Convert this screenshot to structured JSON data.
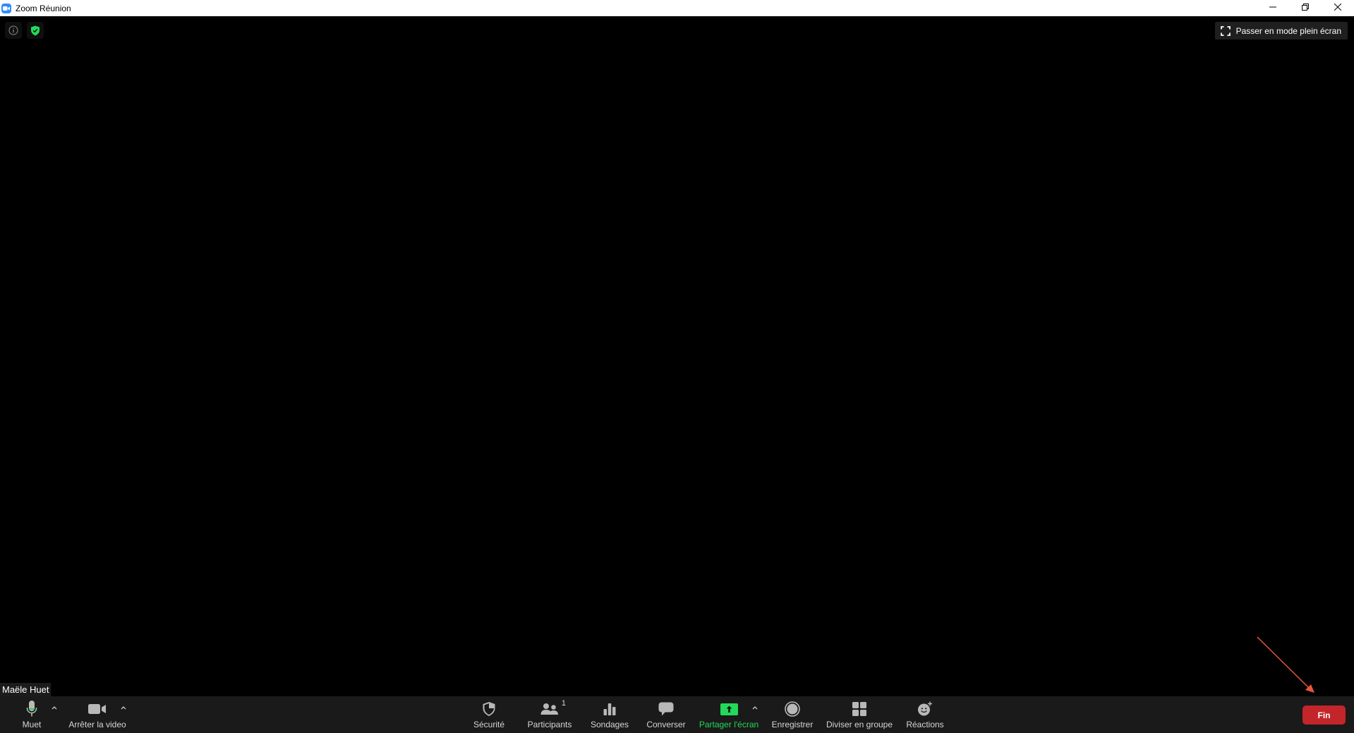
{
  "window": {
    "title": "Zoom Réunion",
    "icon": "zoom-camera-icon",
    "controls": [
      "minimize-icon",
      "restore-icon",
      "close-icon"
    ]
  },
  "stage": {
    "info_icon": "info-icon",
    "security_icon": "shield-check-icon",
    "fullscreen_label": "Passer en mode plein écran",
    "participant_name": "Maële Huet"
  },
  "toolbar": {
    "mute_label": "Muet",
    "video_label": "Arrêter la video",
    "security_label": "Sécurité",
    "participants_label": "Participants",
    "participants_count": "1",
    "polls_label": "Sondages",
    "chat_label": "Converser",
    "share_label": "Partager l'écran",
    "record_label": "Enregistrer",
    "breakout_label": "Diviser en groupe",
    "reactions_label": "Réactions",
    "end_label": "Fin"
  },
  "colors": {
    "accent_green": "#23d959",
    "end_red": "#c2262a",
    "zoom_blue": "#2d8cff",
    "annotation_arrow": "#e8553f"
  }
}
